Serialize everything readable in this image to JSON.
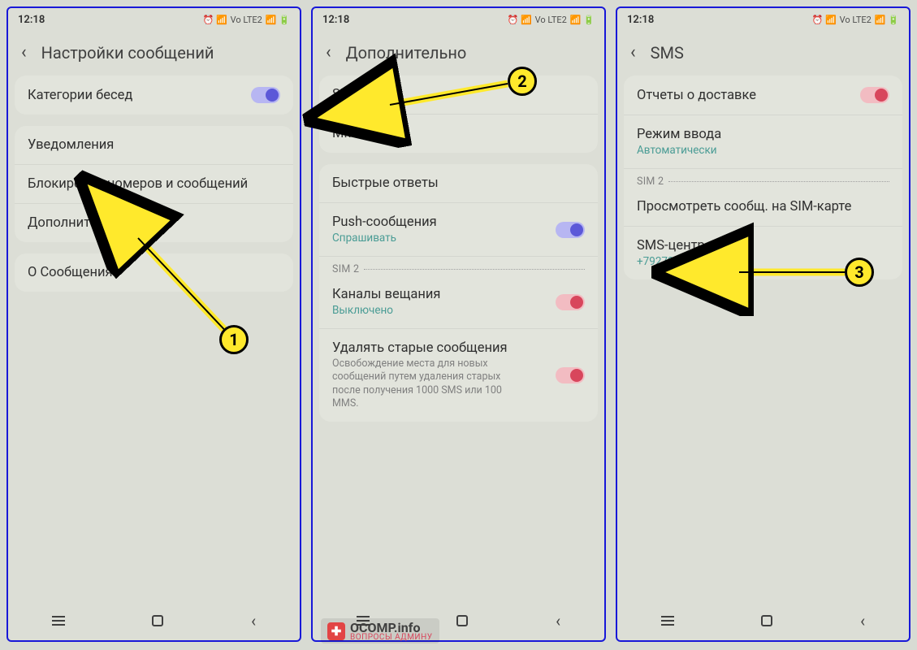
{
  "status": {
    "time": "12:18",
    "net": "Vo LTE2"
  },
  "screens": [
    {
      "title": "Настройки сообщений",
      "g1": {
        "categories": "Категории бесед"
      },
      "g2": {
        "notif": "Уведомления",
        "block": "Блокировка номеров и сообщений",
        "more": "Дополнительно"
      },
      "g3": {
        "about": "О Сообщения"
      }
    },
    {
      "title": "Дополнительно",
      "g1": {
        "sms": "SMS",
        "mms": "MMS"
      },
      "g2": {
        "quick": "Быстрые ответы",
        "push": "Push-сообщения",
        "push_sub": "Спрашивать",
        "sim": "SIM 2",
        "broadcast": "Каналы вещания",
        "broadcast_sub": "Выключено",
        "delold": "Удалять старые сообщения",
        "delold_desc": "Освобождение места для новых сообщений путем удаления старых после получения 1000 SMS или 100 MMS."
      }
    },
    {
      "title": "SMS",
      "g1": {
        "delivery": "Отчеты о доставке",
        "input": "Режим ввода",
        "input_sub": "Автоматически",
        "sim": "SIM 2",
        "viewsim": "Просмотреть сообщ. на SIM-карте",
        "smsc": "SMS-центр",
        "smsc_sub": "+79272909090"
      }
    }
  ],
  "annotations": {
    "n1": "1",
    "n2": "2",
    "n3": "3"
  },
  "watermark": {
    "brand": "OCOMP.info",
    "sub": "ВОПРОСЫ АДМИНУ"
  }
}
